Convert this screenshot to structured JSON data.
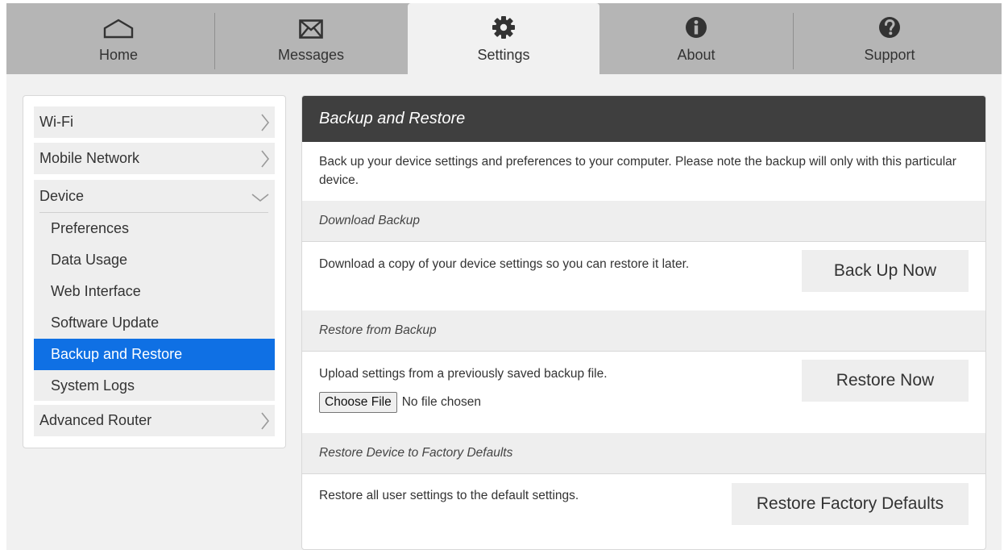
{
  "nav": {
    "tabs": [
      {
        "label": "Home",
        "icon": "home-icon"
      },
      {
        "label": "Messages",
        "icon": "envelope-icon"
      },
      {
        "label": "Settings",
        "icon": "gear-icon"
      },
      {
        "label": "About",
        "icon": "info-icon"
      },
      {
        "label": "Support",
        "icon": "help-icon"
      }
    ],
    "active": "Settings"
  },
  "sidebar": {
    "wifi": "Wi-Fi",
    "mobile_network": "Mobile Network",
    "device": "Device",
    "device_items": [
      "Preferences",
      "Data Usage",
      "Web Interface",
      "Software Update",
      "Backup and Restore",
      "System Logs"
    ],
    "selected": "Backup and Restore",
    "advanced_router": "Advanced Router"
  },
  "main": {
    "title": "Backup and Restore",
    "intro": "Back up your device settings and preferences to your computer. Please note the backup will only with this particular device.",
    "download": {
      "heading": "Download Backup",
      "text": "Download a copy of your device settings so you can restore it later.",
      "button": "Back Up Now"
    },
    "restore": {
      "heading": "Restore from Backup",
      "text": "Upload settings from a previously saved backup file.",
      "choose_file": "Choose File",
      "file_status": "No file chosen",
      "button": "Restore Now"
    },
    "factory": {
      "heading": "Restore Device to Factory Defaults",
      "text": "Restore all user settings to the default settings.",
      "button": "Restore Factory Defaults"
    }
  },
  "colors": {
    "nav_bg": "#b5b5b5",
    "page_bg": "#f1f1f1",
    "header_bg": "#3f3f3f",
    "selected_bg": "#0f70e4"
  }
}
